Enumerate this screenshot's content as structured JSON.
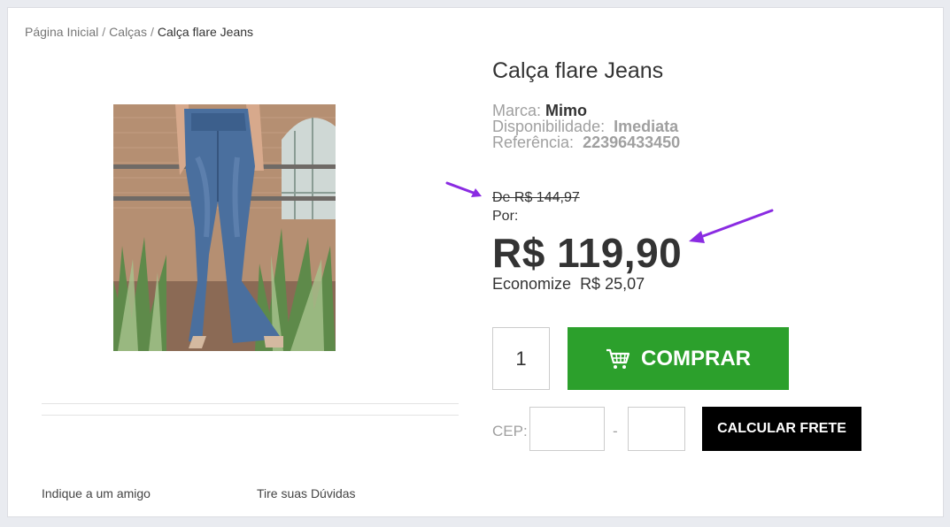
{
  "breadcrumb": {
    "items": [
      "Página Inicial",
      "Calças"
    ],
    "separator": "/",
    "current": "Calça flare Jeans"
  },
  "product": {
    "title": "Calça flare Jeans",
    "brand_label": "Marca:",
    "brand": "Mimo",
    "availability_label": "Disponibilidade:",
    "availability": "Imediata",
    "reference_label": "Referência:",
    "reference": "22396433450"
  },
  "pricing": {
    "old_price": "De R$ 144,97",
    "por_label": "Por:",
    "price": "R$ 119,90",
    "savings_label": "Economize",
    "savings": "R$ 25,07"
  },
  "purchase": {
    "quantity": "1",
    "buy_label": "COMPRAR"
  },
  "shipping": {
    "cep_label": "CEP:",
    "dash": "-",
    "calc_label": "CALCULAR FRETE"
  },
  "links": {
    "indique": "Indique a um amigo",
    "duvidas": "Tire suas Dúvidas"
  },
  "colors": {
    "buy_button": "#2ca02c",
    "freight_button": "#000000",
    "annotation_arrow": "#8a2be2"
  }
}
